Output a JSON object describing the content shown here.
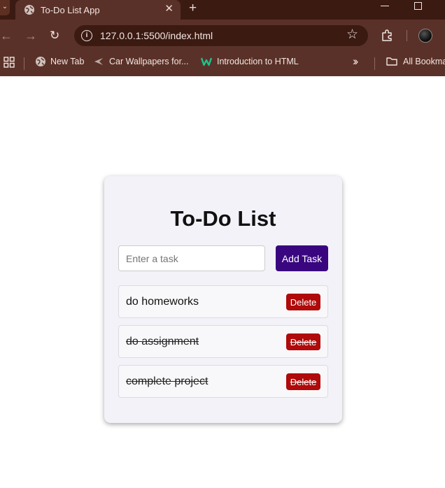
{
  "browser": {
    "tab_title": "To-Do List App",
    "url": "127.0.0.1:5500/index.html",
    "bookmarks": [
      {
        "label": "New Tab",
        "icon": "globe-icon"
      },
      {
        "label": "Car Wallpapers for...",
        "icon": "arrow-logo-icon"
      },
      {
        "label": "Introduction to HTML",
        "icon": "w-logo-icon"
      },
      {
        "label": "All Bookmarks",
        "icon": "folder-icon"
      }
    ],
    "colors": {
      "frame": "#3b1a12",
      "toolbar": "#5a3128"
    }
  },
  "app": {
    "title": "To-Do List",
    "input_placeholder": "Enter a task",
    "input_value": "",
    "add_button_label": "Add Task",
    "delete_label": "Delete",
    "tasks": [
      {
        "text": "do homeworks",
        "completed": false
      },
      {
        "text": "do assignment",
        "completed": true
      },
      {
        "text": "complete project",
        "completed": true
      }
    ],
    "colors": {
      "add_button": "#3a0680",
      "delete_button": "#b00a0a",
      "card": "#f3f2f8"
    }
  }
}
